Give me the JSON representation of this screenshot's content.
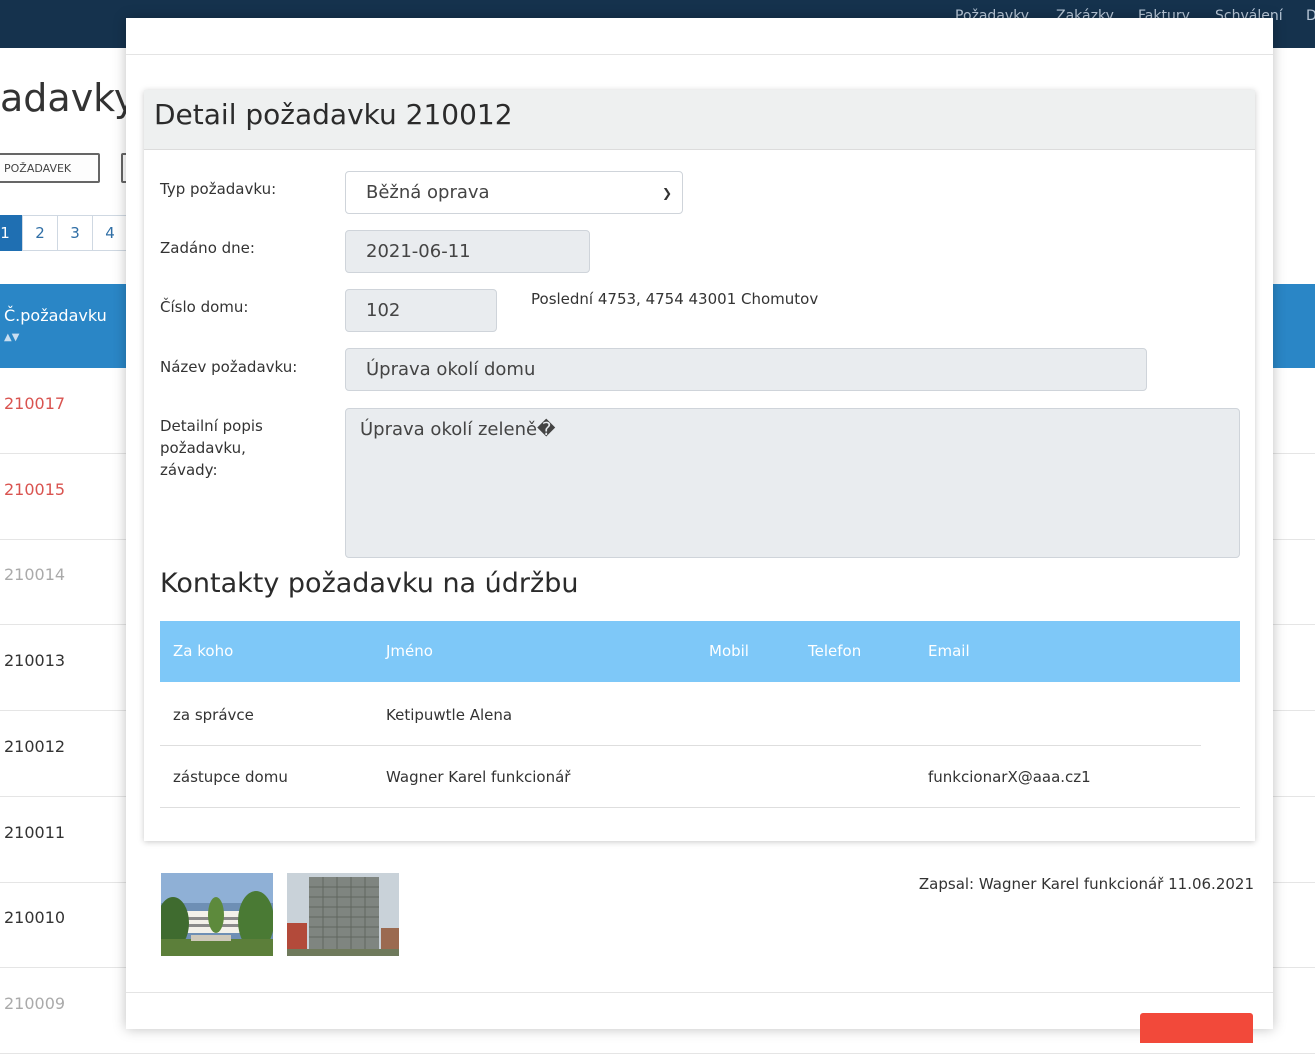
{
  "background": {
    "nav_items": [
      "Požadavky",
      "Zakázky",
      "Faktury",
      "Schválení",
      "D"
    ],
    "page_title_fragment": "adavky",
    "new_request_label": "POŽADAVEK",
    "pages": [
      "1",
      "2",
      "3",
      "4"
    ],
    "table_header": "Č.požadavku",
    "rows": [
      {
        "id": "210017",
        "color": "#d9534f"
      },
      {
        "id": "210015",
        "color": "#d9534f"
      },
      {
        "id": "210014",
        "color": "#aaaaaa"
      },
      {
        "id": "210013",
        "color": "#333333"
      },
      {
        "id": "210012",
        "color": "#333333"
      },
      {
        "id": "210011",
        "color": "#333333"
      },
      {
        "id": "210010",
        "color": "#333333"
      },
      {
        "id": "210009",
        "color": "#aaaaaa"
      }
    ]
  },
  "modal": {
    "title": "Detail požadavku 210012",
    "form": {
      "type_label": "Typ požadavku:",
      "type_value": "Běžná oprava",
      "date_label": "Zadáno dne:",
      "date_value": "2021-06-11",
      "house_label": "Číslo domu:",
      "house_value": "102",
      "address": "Poslední 4753, 4754 43001 Chomutov",
      "name_label": "Název požadavku:",
      "name_value": "Úprava okolí domu",
      "desc_label": "Detailní popis požadavku, závady:",
      "desc_value": "Úprava okolí zeleně�"
    },
    "contacts": {
      "title": "Kontakty požadavku na údržbu",
      "headers": [
        "Za koho",
        "Jméno",
        "Mobil",
        "Telefon",
        "Email"
      ],
      "rows": [
        {
          "role": "za správce",
          "name": "Ketipuwtle Alena",
          "mobile": "",
          "phone": "",
          "email": ""
        },
        {
          "role": "zástupce domu",
          "name": "Wagner Karel funkcionář",
          "mobile": "",
          "phone": "",
          "email": "funkcionarX@aaa.cz1"
        }
      ]
    },
    "recorded_by": "Zapsal: Wagner Karel funkcionář 11.06.2021",
    "photos": [
      "photo-park-building",
      "photo-tall-building"
    ]
  },
  "colors": {
    "nav_bg": "#15324d",
    "table_head": "#2a86c6",
    "contacts_head": "#7ec8f8",
    "close_button": "#f2493a"
  }
}
